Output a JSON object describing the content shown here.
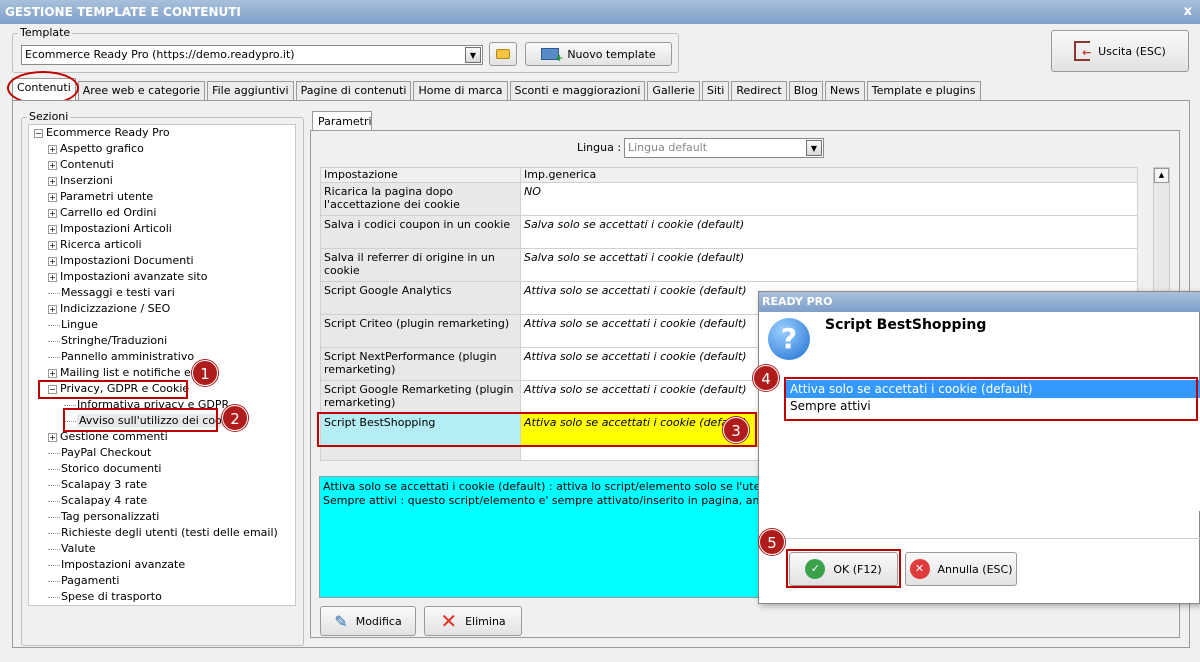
{
  "window": {
    "title": "GESTIONE TEMPLATE E CONTENUTI",
    "close": "x"
  },
  "template": {
    "legend": "Template",
    "selected": "Ecommerce Ready Pro (https://demo.readypro.it)",
    "new_label": "Nuovo template"
  },
  "exit_label": "Uscita (ESC)",
  "tabs": [
    "Contenuti",
    "Aree web e categorie",
    "File aggiuntivi",
    "Pagine di contenuti",
    "Home di marca",
    "Sconti e maggiorazioni",
    "Gallerie",
    "Siti",
    "Redirect",
    "Blog",
    "News",
    "Template e plugins"
  ],
  "sections": {
    "legend": "Sezioni",
    "root": "Ecommerce Ready Pro",
    "items": [
      "Aspetto grafico",
      "Contenuti",
      "Inserzioni",
      "Parametri utente",
      "Carrello ed Ordini",
      "Impostazioni Articoli",
      "Ricerca articoli",
      "Impostazioni Documenti",
      "Impostazioni avanzate sito",
      "Messaggi e testi vari",
      "Indicizzazione / SEO",
      "Lingue",
      "Stringhe/Traduzioni",
      "Pannello amministrativo",
      "Mailing list e notifiche email",
      "Privacy, GDPR e Cookie",
      "Informativa privacy e GDPR",
      "Avviso sull'utilizzo dei cookie",
      "Gestione commenti",
      "PayPal Checkout",
      "Storico documenti",
      "Scalapay 3 rate",
      "Scalapay 4 rate",
      "Tag personalizzati",
      "Richieste degli utenti (testi delle email)",
      "Valute",
      "Impostazioni avanzate",
      "Pagamenti",
      "Spese di trasporto"
    ]
  },
  "params": {
    "tab": "Parametri",
    "lingua_label": "Lingua :",
    "lingua_value": "Lingua default",
    "col1": "Impostazione",
    "col2": "Imp.generica",
    "rows": [
      {
        "k": "Ricarica la pagina dopo l'accettazione dei cookie",
        "v": "NO"
      },
      {
        "k": "Salva i codici coupon in un cookie",
        "v": "Salva solo se accettati i cookie (default)"
      },
      {
        "k": "Salva il referrer di origine in un cookie",
        "v": "Salva solo se accettati i cookie (default)"
      },
      {
        "k": "Script Google Analytics",
        "v": "Attiva solo se accettati i cookie (default)"
      },
      {
        "k": "Script Criteo (plugin remarketing)",
        "v": "Attiva solo se accettati i cookie (default)"
      },
      {
        "k": "Script NextPerformance (plugin remarketing)",
        "v": "Attiva solo se accettati i cookie (default)"
      },
      {
        "k": "Script Google Remarketing (plugin remarketing)",
        "v": "Attiva solo se accettati i cookie (default)"
      },
      {
        "k": "Script BestShopping",
        "v": "Attiva solo se accettati i cookie (default)"
      },
      {
        "k": "",
        "v": ""
      }
    ],
    "desc1": "Attiva solo se accettati i cookie (default) : attiva lo script/elemento solo se l'utente ha accet",
    "desc2": "Sempre attivi : questo script/elemento e' sempre attivato/inserito in pagina, anche se l'utent",
    "modifica": "Modifica",
    "elimina": "Elimina"
  },
  "dialog": {
    "title": "READY PRO",
    "heading": "Script BestShopping",
    "options": [
      "Attiva solo se accettati i cookie (default)",
      "Sempre attivi"
    ],
    "ok": "OK (F12)",
    "cancel": "Annulla (ESC)"
  },
  "badges": [
    "1",
    "2",
    "3",
    "4",
    "5"
  ],
  "colors": {
    "highlight_row": "#b4eef4",
    "highlight_value": "#ffff00",
    "desc_bg": "#00ffff",
    "annotation_red": "#c00000",
    "selection": "#3399ff"
  }
}
